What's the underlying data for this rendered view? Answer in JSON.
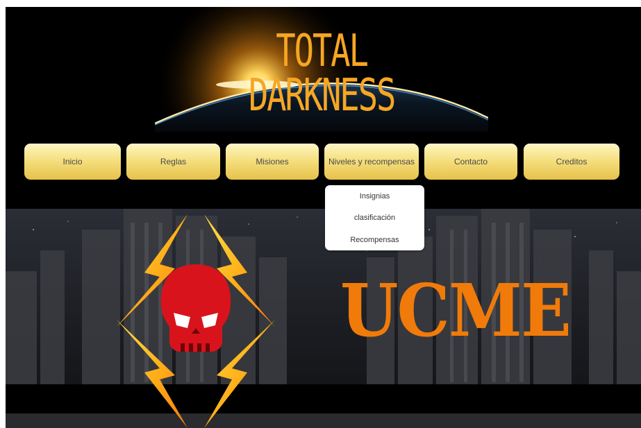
{
  "header": {
    "title": "TOTAL DARKNESS",
    "banner_image": "planet-sunrise-image"
  },
  "nav": {
    "items": [
      {
        "label": "Inicio"
      },
      {
        "label": "Reglas"
      },
      {
        "label": "Misiones"
      },
      {
        "label": "Niveles y recompensas"
      },
      {
        "label": "Contacto"
      },
      {
        "label": "Creditos"
      }
    ],
    "open_dropdown": {
      "parent": "Niveles y recompensas",
      "items": [
        {
          "label": "Insignias"
        },
        {
          "label": "clasificación"
        },
        {
          "label": "Recompensas"
        }
      ]
    }
  },
  "hero": {
    "logo_text": "UCME",
    "emblem_icon": "red-skull-icon",
    "lightning_icon": "lightning-bolt-icon",
    "background_image": "dark-city-street-image"
  },
  "colors": {
    "page_bg": "#000000",
    "title_orange": "#f7a623",
    "button_gold": "#f5df80",
    "ucme_orange": "#f07b0a",
    "skull_red": "#d8131b",
    "bolt_yellow": "#ffc21a"
  }
}
